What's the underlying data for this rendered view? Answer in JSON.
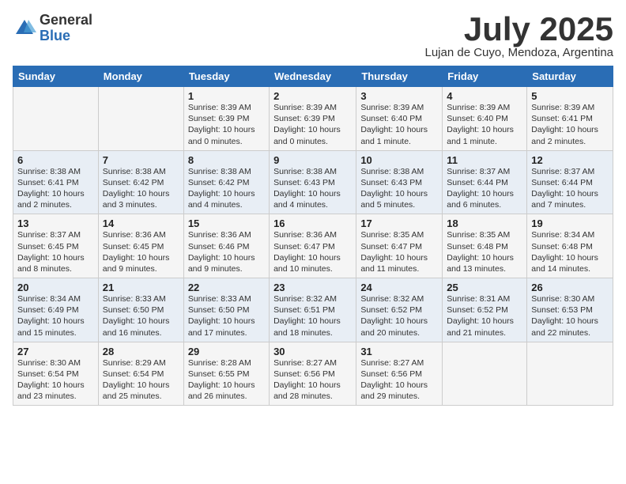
{
  "logo": {
    "general": "General",
    "blue": "Blue"
  },
  "title": "July 2025",
  "location": "Lujan de Cuyo, Mendoza, Argentina",
  "days_of_week": [
    "Sunday",
    "Monday",
    "Tuesday",
    "Wednesday",
    "Thursday",
    "Friday",
    "Saturday"
  ],
  "weeks": [
    [
      {
        "day": "",
        "info": ""
      },
      {
        "day": "",
        "info": ""
      },
      {
        "day": "1",
        "info": "Sunrise: 8:39 AM\nSunset: 6:39 PM\nDaylight: 10 hours and 0 minutes."
      },
      {
        "day": "2",
        "info": "Sunrise: 8:39 AM\nSunset: 6:39 PM\nDaylight: 10 hours and 0 minutes."
      },
      {
        "day": "3",
        "info": "Sunrise: 8:39 AM\nSunset: 6:40 PM\nDaylight: 10 hours and 1 minute."
      },
      {
        "day": "4",
        "info": "Sunrise: 8:39 AM\nSunset: 6:40 PM\nDaylight: 10 hours and 1 minute."
      },
      {
        "day": "5",
        "info": "Sunrise: 8:39 AM\nSunset: 6:41 PM\nDaylight: 10 hours and 2 minutes."
      }
    ],
    [
      {
        "day": "6",
        "info": "Sunrise: 8:38 AM\nSunset: 6:41 PM\nDaylight: 10 hours and 2 minutes."
      },
      {
        "day": "7",
        "info": "Sunrise: 8:38 AM\nSunset: 6:42 PM\nDaylight: 10 hours and 3 minutes."
      },
      {
        "day": "8",
        "info": "Sunrise: 8:38 AM\nSunset: 6:42 PM\nDaylight: 10 hours and 4 minutes."
      },
      {
        "day": "9",
        "info": "Sunrise: 8:38 AM\nSunset: 6:43 PM\nDaylight: 10 hours and 4 minutes."
      },
      {
        "day": "10",
        "info": "Sunrise: 8:38 AM\nSunset: 6:43 PM\nDaylight: 10 hours and 5 minutes."
      },
      {
        "day": "11",
        "info": "Sunrise: 8:37 AM\nSunset: 6:44 PM\nDaylight: 10 hours and 6 minutes."
      },
      {
        "day": "12",
        "info": "Sunrise: 8:37 AM\nSunset: 6:44 PM\nDaylight: 10 hours and 7 minutes."
      }
    ],
    [
      {
        "day": "13",
        "info": "Sunrise: 8:37 AM\nSunset: 6:45 PM\nDaylight: 10 hours and 8 minutes."
      },
      {
        "day": "14",
        "info": "Sunrise: 8:36 AM\nSunset: 6:45 PM\nDaylight: 10 hours and 9 minutes."
      },
      {
        "day": "15",
        "info": "Sunrise: 8:36 AM\nSunset: 6:46 PM\nDaylight: 10 hours and 9 minutes."
      },
      {
        "day": "16",
        "info": "Sunrise: 8:36 AM\nSunset: 6:47 PM\nDaylight: 10 hours and 10 minutes."
      },
      {
        "day": "17",
        "info": "Sunrise: 8:35 AM\nSunset: 6:47 PM\nDaylight: 10 hours and 11 minutes."
      },
      {
        "day": "18",
        "info": "Sunrise: 8:35 AM\nSunset: 6:48 PM\nDaylight: 10 hours and 13 minutes."
      },
      {
        "day": "19",
        "info": "Sunrise: 8:34 AM\nSunset: 6:48 PM\nDaylight: 10 hours and 14 minutes."
      }
    ],
    [
      {
        "day": "20",
        "info": "Sunrise: 8:34 AM\nSunset: 6:49 PM\nDaylight: 10 hours and 15 minutes."
      },
      {
        "day": "21",
        "info": "Sunrise: 8:33 AM\nSunset: 6:50 PM\nDaylight: 10 hours and 16 minutes."
      },
      {
        "day": "22",
        "info": "Sunrise: 8:33 AM\nSunset: 6:50 PM\nDaylight: 10 hours and 17 minutes."
      },
      {
        "day": "23",
        "info": "Sunrise: 8:32 AM\nSunset: 6:51 PM\nDaylight: 10 hours and 18 minutes."
      },
      {
        "day": "24",
        "info": "Sunrise: 8:32 AM\nSunset: 6:52 PM\nDaylight: 10 hours and 20 minutes."
      },
      {
        "day": "25",
        "info": "Sunrise: 8:31 AM\nSunset: 6:52 PM\nDaylight: 10 hours and 21 minutes."
      },
      {
        "day": "26",
        "info": "Sunrise: 8:30 AM\nSunset: 6:53 PM\nDaylight: 10 hours and 22 minutes."
      }
    ],
    [
      {
        "day": "27",
        "info": "Sunrise: 8:30 AM\nSunset: 6:54 PM\nDaylight: 10 hours and 23 minutes."
      },
      {
        "day": "28",
        "info": "Sunrise: 8:29 AM\nSunset: 6:54 PM\nDaylight: 10 hours and 25 minutes."
      },
      {
        "day": "29",
        "info": "Sunrise: 8:28 AM\nSunset: 6:55 PM\nDaylight: 10 hours and 26 minutes."
      },
      {
        "day": "30",
        "info": "Sunrise: 8:27 AM\nSunset: 6:56 PM\nDaylight: 10 hours and 28 minutes."
      },
      {
        "day": "31",
        "info": "Sunrise: 8:27 AM\nSunset: 6:56 PM\nDaylight: 10 hours and 29 minutes."
      },
      {
        "day": "",
        "info": ""
      },
      {
        "day": "",
        "info": ""
      }
    ]
  ]
}
